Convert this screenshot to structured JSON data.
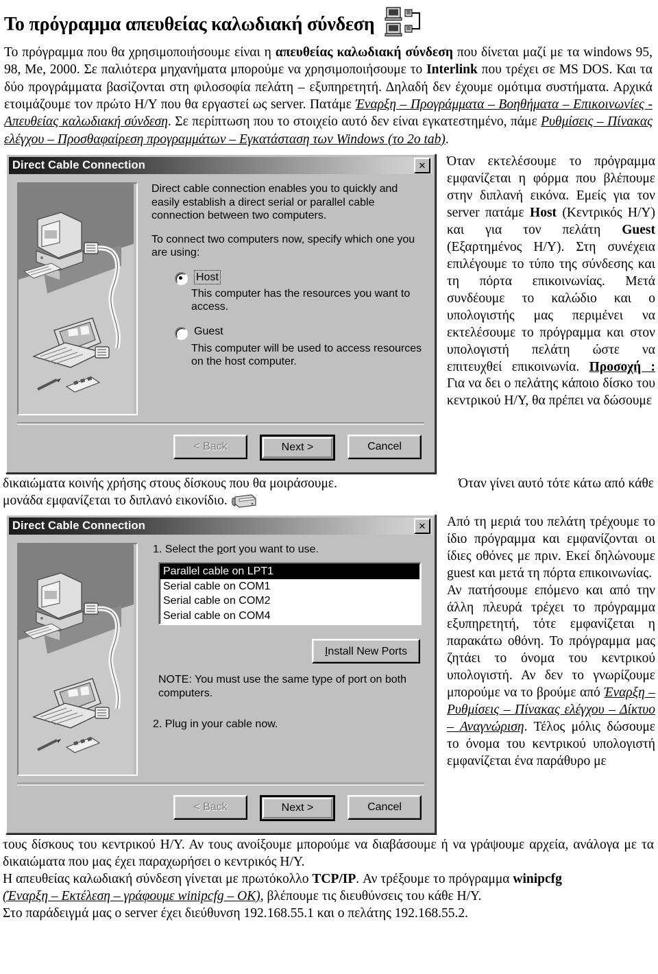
{
  "document": {
    "title": "Το πρόγραμμα απευθείας καλωδιακή σύνδεση",
    "title_icon": "two-computers-cable-icon"
  },
  "intro": {
    "p1_a": "Το πρόγραμμα που θα χρησιμοποιήσουμε είναι η ",
    "p1_b": "απευθείας καλωδιακή σύνδεση",
    "p1_c": " που δίνεται μαζί με τα windows 95, 98, Me, 2000. Σε παλιότερα μηχανήματα μπορούμε να χρησιμοποιήσουμε το ",
    "p1_d": "Interlink",
    "p1_e": " που τρέχει σε MS DOS. Και τα δύο προγράμματα βασίζονται στη φιλοσοφία πελάτη – εξυπηρετητή. Δηλαδή δεν έχουμε ομότιμα συστήματα. Αρχικά ετοιμάζουμε τον πρώτο Η/Υ που θα εργαστεί ως server. Πατάμε ",
    "path1": "Έναρξη – Προγράμματα – Βοηθήματα – Επικοινωνίες - Απευθείας καλωδιακή σύνδεση",
    "p1_f": ". Σε περίπτωση που το στοιχείο αυτό δεν είναι εγκατεστημένο, πάμε ",
    "path2": "Ρυθμίσεις – Πίνακας ελέγχου – Προσθαφαίρεση προγραμμάτων – Εγκατάσταση των Windows (το 2ο tab)",
    "p1_g": "."
  },
  "right_column": {
    "para1": "Όταν εκτελέσουμε το πρόγραμμα εμφανίζεται η φόρμα που βλέπουμε στην διπλανή εικόνα. Εμείς για τον server πατάμε ",
    "host_bold": "Host",
    "para2": " (Κεντρικός Η/Υ) και για τον πελάτη ",
    "guest_bold": "Guest",
    "para3": " (Εξαρτημένος Η/Υ). Στη συνέχεια επιλέγουμε το τύπο της σύνδεσης και τη πόρτα επικοινωνίας. Μετά συνδέουμε το καλώδιο και ο υπολογιστής μας περιμένει να εκτελέσουμε το πρόγραμμα και στον υπολογιστή πελάτη ώστε να επιτευχθεί επικοινωνία. ",
    "warning_label": "Προσοχή :",
    "para4": " Για να δει ο πελάτης κάποιο δίσκο του κεντρικού Η/Υ, θα πρέπει να δώσουμε",
    "para5": "Από τη μεριά του πελάτη τρέχουμε το ίδιο πρόγραμμα και εμφανίζονται οι ίδιες οθόνες με πριν. Εκεί δηλώνουμε guest και μετά τη πόρτα επικοινωνίας.",
    "para6": " Αν πατήσουμε επόμενο και από την άλλη πλευρά τρέχει το πρόγραμμα εξυπηρετητή, τότε εμφανίζεται η παρακάτω οθόνη. Το πρόγραμμα  μας ζητάει το όνομα του κεντρικού υπολογιστή. Αν δεν το γνωρίζουμε μπορούμε να το βρούμε από ",
    "path3": "Έναρξη – Ρυθμίσεις – Πίνακας ελέγχου – Δίκτυο – Αναγνώριση",
    "para7": ". Τέλος μόλις δώσουμε το όνομα του κεντρικού υπολογιστή εμφανίζεται ένα παράθυρο με"
  },
  "middle_text": {
    "line1_left": "δικαιώματα κοινής χρήσης στους δίσκους που θα μοιράσουμε.",
    "line1_right": "Όταν γίνει αυτό τότε κάτω από κάθε",
    "line2": "μονάδα εμφανίζεται το διπλανό εικονίδιο.",
    "drive_icon": "shared-drive-icon"
  },
  "dialog1": {
    "title": "Direct Cable Connection",
    "close_label": "✕",
    "illustration": "two-computers-cable-illustration",
    "para1": "Direct cable connection enables you to quickly and easily establish a direct serial or parallel cable connection between two computers.",
    "para2": "To connect two computers now, specify which one you are using:",
    "radio_host_label": "Host",
    "radio_host_accesskey": "H",
    "radio_host_desc": "This computer has the resources you want to access.",
    "radio_guest_label": "Guest",
    "radio_guest_accesskey": "G",
    "radio_guest_desc": "This computer will be used to access resources on the host computer.",
    "selected": "Host",
    "btn_back": "< Back",
    "btn_back_key": "B",
    "btn_next": "Next >",
    "btn_next_key": "N",
    "btn_cancel": "Cancel"
  },
  "dialog2": {
    "title": "Direct Cable Connection",
    "close_label": "✕",
    "illustration": "two-computers-cable-illustration",
    "step1_pre": "1. Select the ",
    "step1_key": "p",
    "step1_post": "ort you want to use.",
    "ports": [
      "Parallel cable on LPT1",
      "Serial cable on COM1",
      "Serial cable on COM2",
      "Serial cable on COM4"
    ],
    "selected_port": "Parallel cable on LPT1",
    "install_button_key": "I",
    "install_button_rest": "nstall New Ports",
    "note": "NOTE: You must use the same type of port on both computers.",
    "step2": "2. Plug in your cable now.",
    "btn_back": "< Back",
    "btn_back_key": "B",
    "btn_next": "Next >",
    "btn_next_key": "N",
    "btn_cancel": "Cancel"
  },
  "bottom": {
    "l1": "τους δίσκους του κεντρικού Η/Υ. Αν τους ανοίξουμε μπορούμε να διαβάσουμε ή να γράψουμε αρχεία, ανάλογα με τα δικαιώματα που μας έχει παραχωρήσει ο κεντρικός Η/Υ.",
    "l2_a": "Η απευθείας καλωδιακή σύνδεση γίνεται με πρωτόκολλο ",
    "l2_b": "TCP/IP",
    "l2_c": ". Αν τρέξουμε το πρόγραμμα ",
    "l2_d": "winipcfg",
    "l3_path": "(Έναρξη – Εκτέλεση – γράφουμε winipcfg – OK)",
    "l3_rest": ",  βλέπουμε τις διευθύνσεις του κάθε Η/Υ.",
    "l4": "Στο παράδειγμά μας ο server έχει διεύθυνση 192.168.55.1 και ο πελάτης 192.168.55.2."
  },
  "colors": {
    "dialog_face": "#c0c0c0",
    "titlebar_dark": "#1a1a1a",
    "titlebar_light": "#d4d4d4",
    "selection": "#000000"
  }
}
